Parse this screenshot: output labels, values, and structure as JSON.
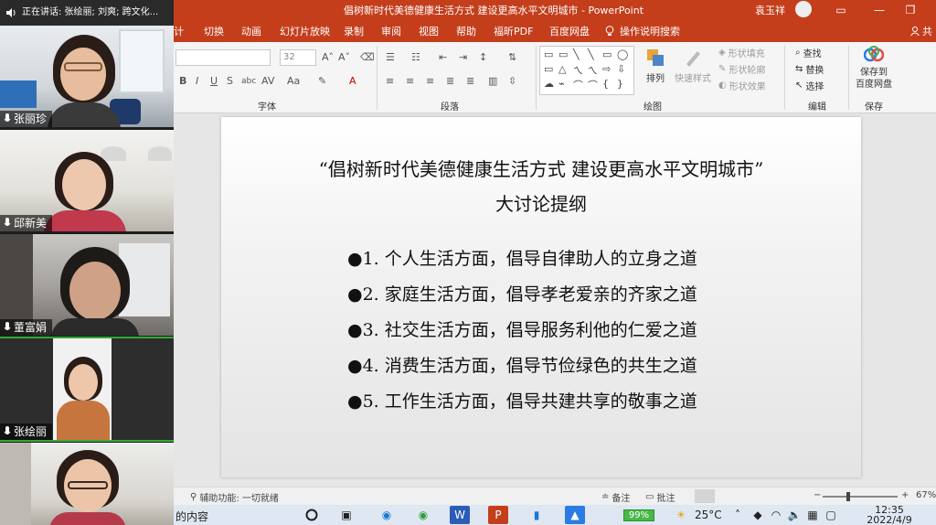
{
  "meeting": {
    "speaking_label": "正在讲话: 张绘丽; 刘爽; 跨文化...",
    "participants": [
      {
        "name": "张丽珍"
      },
      {
        "name": "邱新美"
      },
      {
        "name": "董富娟"
      },
      {
        "name": "张绘丽"
      },
      {
        "name": ""
      }
    ]
  },
  "window": {
    "title": "倡树新时代美德健康生活方式 建设更高水平文明城市 - PowerPoint",
    "user": "袁玉祥",
    "share_label": "共"
  },
  "tabs": [
    "计",
    "切换",
    "动画",
    "幻灯片放映",
    "录制",
    "审阅",
    "视图",
    "帮助",
    "福昕PDF",
    "百度网盘"
  ],
  "tell_me": "操作说明搜索",
  "ribbon": {
    "font_size": "32",
    "groups": {
      "font": "字体",
      "paragraph": "段落",
      "drawing": "绘图",
      "editing": "编辑",
      "save": "保存"
    },
    "arrange": "排列",
    "quick_styles": "快速样式",
    "shape_fill": "形状填充",
    "shape_outline": "形状轮廓",
    "shape_effects": "形状效果",
    "find": "查找",
    "replace": "替换",
    "select": "选择",
    "save_to_baidu": "保存到\n百度网盘"
  },
  "slide": {
    "title_line1": "“倡树新时代美德健康生活方式  建设更高水平文明城市”",
    "title_line2": "大讨论提纲",
    "bullets": [
      "●1. 个人生活方面，倡导自律助人的立身之道",
      "●2. 家庭生活方面，倡导孝老爱亲的齐家之道",
      "●3. 社交生活方面，倡导服务利他的仁爱之道",
      "●4. 消费生活方面，倡导节俭绿色的共生之道",
      "●5. 工作生活方面，倡导共建共享的敬事之道"
    ]
  },
  "status": {
    "accessibility": "辅助功能: 一切就绪",
    "notes": "备注",
    "comments": "批注",
    "zoom": "67%",
    "zoom_fraction": 0.32
  },
  "taskbar": {
    "search_text": "的内容",
    "battery": "99%",
    "weather": "25°C",
    "time": "12:35",
    "date": "2022/4/9"
  },
  "colors": {
    "accent": "#c43e1c",
    "ribbon_bg": "#f5f5f5"
  }
}
